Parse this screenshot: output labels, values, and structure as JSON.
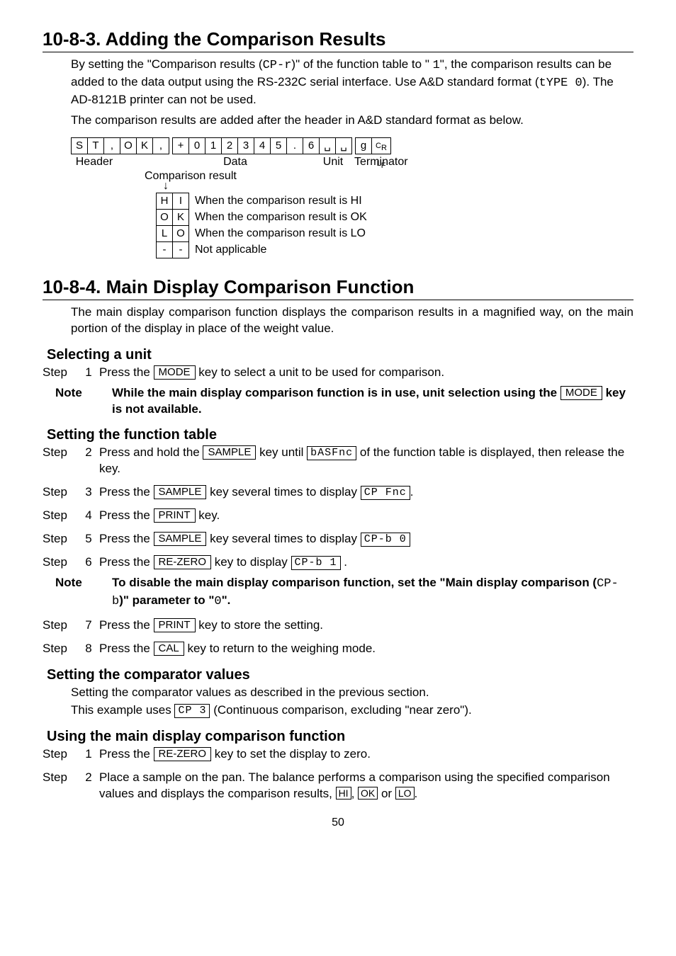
{
  "section1": {
    "title": "10-8-3.   Adding the Comparison Results",
    "p1a": "By setting the \"Comparison results (",
    "p1code": "CP-r",
    "p1b": ")\" of the function table to \" ",
    "p1code2": "1",
    "p1c": "\", the comparison results can be added to the data output using the RS-232C serial interface. Use A&D standard format (",
    "p1code3": "tYPE  0",
    "p1d": "). The AD-8121B printer can not be used.",
    "p2": "The comparison results are added after the header in A&D standard format as below.",
    "bytes": [
      "S",
      "T",
      ",",
      "O",
      "K",
      ",",
      "",
      "+",
      "0",
      "1",
      "2",
      "3",
      "4",
      "5",
      ".",
      "6",
      "␣",
      "␣",
      "",
      "g",
      "CR LF"
    ],
    "lbl_header": "Header",
    "lbl_data": "Data",
    "lbl_unit": "Unit",
    "lbl_term": "Terminator",
    "lbl_comp": "Comparison result",
    "cmp": [
      {
        "c1": "H",
        "c2": "I",
        "txt": "When the comparison result is HI"
      },
      {
        "c1": "O",
        "c2": "K",
        "txt": "When the comparison result is OK"
      },
      {
        "c1": "L",
        "c2": "O",
        "txt": "When the comparison result is LO"
      },
      {
        "c1": "-",
        "c2": "-",
        "txt": "Not applicable"
      }
    ]
  },
  "section2": {
    "title": "10-8-4.   Main Display Comparison Function",
    "p1": "The main display comparison function displays the comparison results in a magnified way, on the main portion of the display in place of the weight value.",
    "sub1": "Selecting a unit",
    "s1_step": "Step",
    "s1_n": "1",
    "s1_a": "Press the ",
    "s1_key": "MODE",
    "s1_b": " key to select a unit to be used for comparison.",
    "note1a": "Note",
    "note1b": "While the main display comparison function is in use, unit selection using the ",
    "note1key": "MODE",
    "note1c": " key is not available.",
    "sub2": "Setting the function table",
    "s2_n": "2",
    "s2_a": "Press and hold the ",
    "s2_key": "SAMPLE",
    "s2_b": " key until ",
    "s2_lcd": "bASFnc",
    "s2_c": " of the function table is displayed, then release the key.",
    "s3_n": "3",
    "s3_a": "Press the ",
    "s3_key": "SAMPLE",
    "s3_b": " key several times to display ",
    "s3_lcd": "CP Fnc",
    "s3_c": ".",
    "s4_n": "4",
    "s4_a": "Press the ",
    "s4_key": "PRINT",
    "s4_b": " key.",
    "s5_n": "5",
    "s5_a": "Press the ",
    "s5_key": "SAMPLE",
    "s5_b": " key several times to display ",
    "s5_lcd": "CP-b 0",
    "s6_n": "6",
    "s6_a": "Press the ",
    "s6_key": "RE-ZERO",
    "s6_b": " key to display ",
    "s6_lcd": "CP-b 1",
    "s6_c": " .",
    "note6a": "Note",
    "note6b": "To disable the main display comparison function, set the \"Main display comparison (",
    "note6code": "CP-b",
    "note6c": ")\" parameter to \"",
    "note6code2": "0",
    "note6d": "\".",
    "s7_n": "7",
    "s7_a": "Press the ",
    "s7_key": "PRINT",
    "s7_b": " key to store the setting.",
    "s8_n": "8",
    "s8_a": "Press the ",
    "s8_key": "CAL",
    "s8_b": " key to return to the weighing mode.",
    "sub3": "Setting the comparator values",
    "p3a": "Setting the comparator values as described in the previous section.",
    "p3b_a": "This example uses ",
    "p3b_lcd": "CP 3",
    "p3b_b": " (Continuous comparison, excluding \"near zero\").",
    "sub4": "Using the main display comparison function",
    "u1_n": "1",
    "u1_a": "Press the ",
    "u1_key": "RE-ZERO",
    "u1_b": " key to set the display to zero.",
    "u2_n": "2",
    "u2_a": "Place a sample on the pan. The balance performs a comparison using the specified comparison values and displays the comparison results, ",
    "u2_hi": "HI",
    "u2_ok": "OK",
    "u2_lo": "LO",
    "u2_or": " or ",
    "u2_comma": ", ",
    "u2_period": "."
  },
  "pagenum": "50"
}
